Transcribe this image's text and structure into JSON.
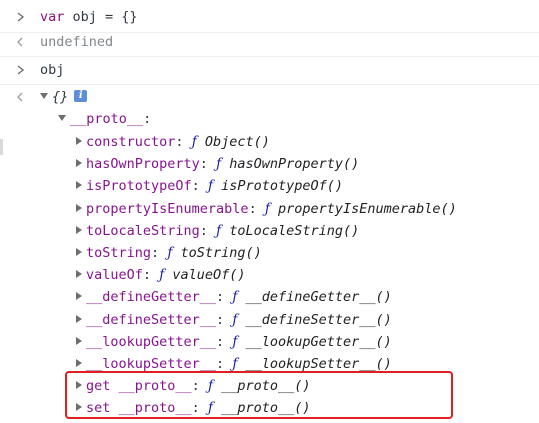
{
  "console": {
    "input1": {
      "kw": "var",
      "rest": " obj = {}"
    },
    "output1": "undefined",
    "input2": "obj",
    "object_label": "{}",
    "info_badge": "i",
    "proto_label": "__proto__",
    "proto_colon": ":",
    "fn_symbol": "ƒ",
    "proto_items": [
      {
        "key": "constructor",
        "fn": "Object()"
      },
      {
        "key": "hasOwnProperty",
        "fn": "hasOwnProperty()"
      },
      {
        "key": "isPrototypeOf",
        "fn": "isPrototypeOf()"
      },
      {
        "key": "propertyIsEnumerable",
        "fn": "propertyIsEnumerable()"
      },
      {
        "key": "toLocaleString",
        "fn": "toLocaleString()"
      },
      {
        "key": "toString",
        "fn": "toString()"
      },
      {
        "key": "valueOf",
        "fn": "valueOf()"
      },
      {
        "key": "__defineGetter__",
        "fn": "__defineGetter__()"
      },
      {
        "key": "__defineSetter__",
        "fn": "__defineSetter__()"
      },
      {
        "key": "__lookupGetter__",
        "fn": "__lookupGetter__()"
      },
      {
        "key": "__lookupSetter__",
        "fn": "__lookupSetter__()"
      },
      {
        "key": "get __proto__",
        "fn": "__proto__()"
      },
      {
        "key": "set __proto__",
        "fn": "__proto__()"
      }
    ]
  },
  "colors": {
    "keyword": "#881280",
    "property": "#881391",
    "fn_symbol": "#1a1aa6",
    "highlight": "#e02020"
  }
}
